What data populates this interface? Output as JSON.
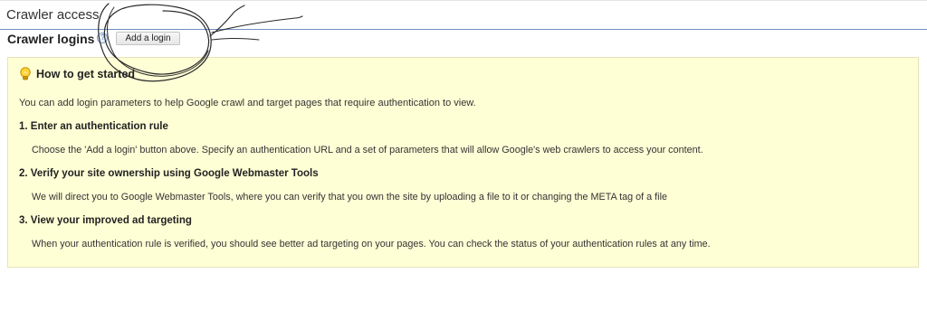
{
  "header": {
    "section_title": "Crawler access"
  },
  "logins": {
    "title": "Crawler logins",
    "help_glyph": "?",
    "add_button_label": "Add a login"
  },
  "info_box": {
    "heading": "How to get started",
    "intro": "You can add login parameters to help Google crawl and target pages that require authentication to view.",
    "steps": [
      {
        "title": "1. Enter an authentication rule",
        "desc": "Choose the 'Add a login' button above. Specify an authentication URL and a set of parameters that will allow Google's web crawlers to access your content."
      },
      {
        "title": "2. Verify your site ownership using Google Webmaster Tools",
        "desc": "We will direct you to Google Webmaster Tools, where you can verify that you own the site by uploading a file to it or changing the META tag of a file"
      },
      {
        "title": "3. View your improved ad targeting",
        "desc": "When your authentication rule is verified, you should see better ad targeting on your pages. You can check the status of your authentication rules at any time."
      }
    ]
  },
  "colors": {
    "box_background": "#ffffd6",
    "box_border": "#e6e3b8",
    "header_rule": "#6f8fc2"
  },
  "icons": {
    "help": "help-icon",
    "bulb": "lightbulb-icon"
  }
}
